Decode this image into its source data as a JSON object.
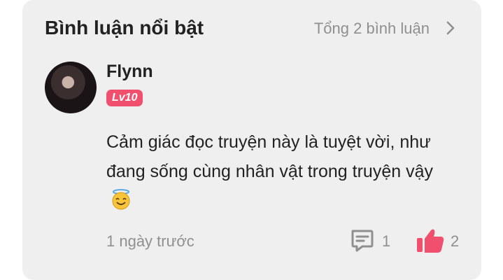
{
  "header": {
    "title": "Bình luận nổi bật",
    "total": "Tổng 2 bình luận"
  },
  "comment": {
    "username": "Flynn",
    "level": "Lv10",
    "text": "Cảm giác đọc truyện này là tuyệt vời, như đang sống cùng nhân vật trong truyện vậy",
    "emoji": "smiling-face-with-halo",
    "time": "1 ngày trước",
    "replies": "1",
    "likes": "2"
  },
  "colors": {
    "card_bg": "#efefef",
    "badge": "#f0506e",
    "like": "#f0506e",
    "muted": "#8f8f8f"
  }
}
